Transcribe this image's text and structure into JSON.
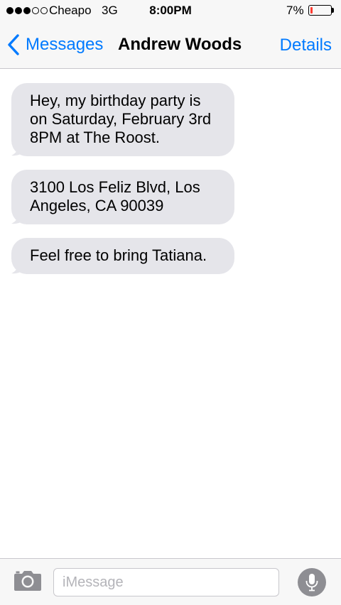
{
  "status_bar": {
    "signal_bars": 3,
    "signal_max": 5,
    "carrier": "Cheapo",
    "network": "3G",
    "time": "8:00PM",
    "battery_percent": "7%",
    "battery_level": 0.07,
    "battery_color": "#ff3b30"
  },
  "nav": {
    "back_label": "Messages",
    "title": "Andrew Woods",
    "details_label": "Details",
    "accent_color": "#007aff"
  },
  "messages": [
    {
      "direction": "incoming",
      "text": "Hey, my birthday party is on Saturday, February 3rd 8PM at The Roost."
    },
    {
      "direction": "incoming",
      "text": "3100 Los Feliz Blvd, Los Angeles, CA 90039"
    },
    {
      "direction": "incoming",
      "text": "Feel free to bring Tatiana."
    }
  ],
  "input_bar": {
    "camera_icon": "camera-icon",
    "placeholder": "iMessage",
    "value": "",
    "mic_icon": "microphone-icon"
  },
  "colors": {
    "incoming_bubble": "#e5e5ea",
    "bar_background": "#f7f7f7"
  }
}
